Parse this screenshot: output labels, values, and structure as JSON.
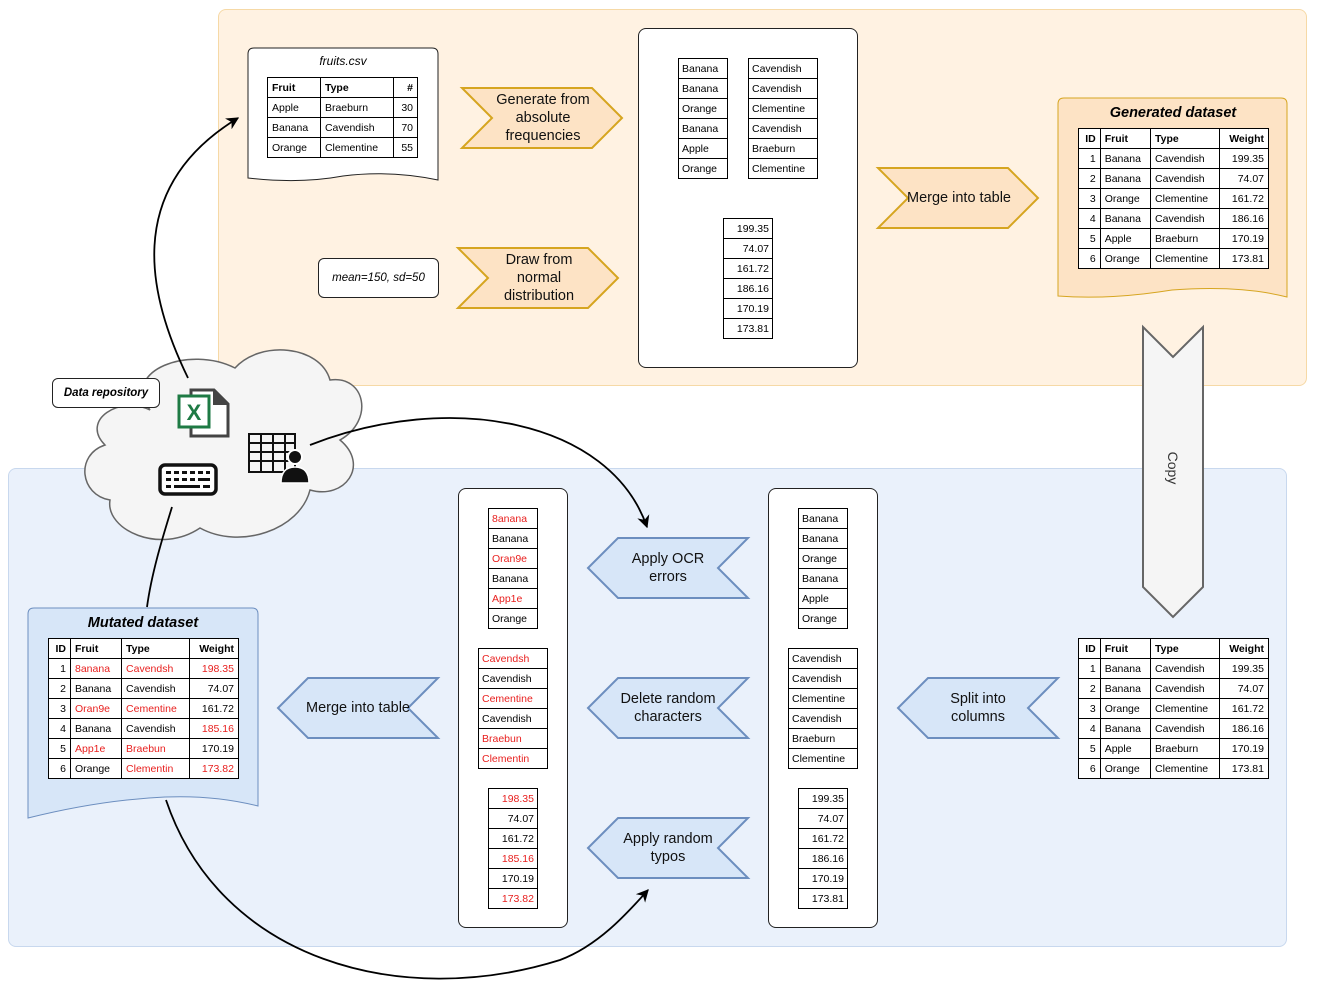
{
  "colors": {
    "top_region_fill": "#fff2e2",
    "top_step_fill": "#fde3c5",
    "top_step_stroke": "#d6a520",
    "bottom_region_fill": "#eaf1fb",
    "bottom_step_fill": "#d7e6f8",
    "bottom_step_stroke": "#6c8ebf",
    "copy_fill": "#f5f5f5",
    "copy_stroke": "#666666",
    "mutation_text": "#e8201f",
    "excel_green": "#1e7a44"
  },
  "repository": {
    "label": "Data repository",
    "icons": [
      "excel-file-icon",
      "keyboard-icon",
      "spreadsheet-user-icon"
    ]
  },
  "source_file": {
    "title": "fruits.csv",
    "headers": [
      "Fruit",
      "Type",
      "#"
    ],
    "rows": [
      [
        "Apple",
        "Braeburn",
        "30"
      ],
      [
        "Banana",
        "Cavendish",
        "70"
      ],
      [
        "Orange",
        "Clementine",
        "55"
      ]
    ]
  },
  "distribution_params": "mean=150, sd=50",
  "steps_top": {
    "generate": "Generate from absolute frequencies",
    "draw": "Draw from normal distribution",
    "merge": "Merge into table"
  },
  "generated_columns": {
    "fruit": [
      "Banana",
      "Banana",
      "Orange",
      "Banana",
      "Apple",
      "Orange"
    ],
    "type": [
      "Cavendish",
      "Cavendish",
      "Clementine",
      "Cavendish",
      "Braeburn",
      "Clementine"
    ],
    "weight": [
      "199.35",
      "74.07",
      "161.72",
      "186.16",
      "170.19",
      "173.81"
    ]
  },
  "generated_dataset": {
    "title": "Generated dataset",
    "headers": [
      "ID",
      "Fruit",
      "Type",
      "Weight"
    ],
    "rows": [
      [
        "1",
        "Banana",
        "Cavendish",
        "199.35"
      ],
      [
        "2",
        "Banana",
        "Cavendish",
        "74.07"
      ],
      [
        "3",
        "Orange",
        "Clementine",
        "161.72"
      ],
      [
        "4",
        "Banana",
        "Cavendish",
        "186.16"
      ],
      [
        "5",
        "Apple",
        "Braeburn",
        "170.19"
      ],
      [
        "6",
        "Orange",
        "Clementine",
        "173.81"
      ]
    ]
  },
  "copy_label": "Copy",
  "copied_dataset": {
    "headers": [
      "ID",
      "Fruit",
      "Type",
      "Weight"
    ],
    "rows": [
      [
        "1",
        "Banana",
        "Cavendish",
        "199.35"
      ],
      [
        "2",
        "Banana",
        "Cavendish",
        "74.07"
      ],
      [
        "3",
        "Orange",
        "Clementine",
        "161.72"
      ],
      [
        "4",
        "Banana",
        "Cavendish",
        "186.16"
      ],
      [
        "5",
        "Apple",
        "Braeburn",
        "170.19"
      ],
      [
        "6",
        "Orange",
        "Clementine",
        "173.81"
      ]
    ]
  },
  "steps_bottom": {
    "split": "Split into columns",
    "ocr": "Apply OCR errors",
    "delete": "Delete random characters",
    "typos": "Apply random typos",
    "merge": "Merge into table"
  },
  "split_columns": {
    "fruit": [
      "Banana",
      "Banana",
      "Orange",
      "Banana",
      "Apple",
      "Orange"
    ],
    "type": [
      "Cavendish",
      "Cavendish",
      "Clementine",
      "Cavendish",
      "Braeburn",
      "Clementine"
    ],
    "weight": [
      "199.35",
      "74.07",
      "161.72",
      "186.16",
      "170.19",
      "173.81"
    ]
  },
  "mutated_columns": {
    "fruit": [
      {
        "v": "8anana",
        "m": true
      },
      {
        "v": "Banana",
        "m": false
      },
      {
        "v": "Oran9e",
        "m": true
      },
      {
        "v": "Banana",
        "m": false
      },
      {
        "v": "App1e",
        "m": true
      },
      {
        "v": "Orange",
        "m": false
      }
    ],
    "type": [
      {
        "v": "Cavendsh",
        "m": true
      },
      {
        "v": "Cavendish",
        "m": false
      },
      {
        "v": "Cementine",
        "m": true
      },
      {
        "v": "Cavendish",
        "m": false
      },
      {
        "v": "Braebun",
        "m": true
      },
      {
        "v": "Clementin",
        "m": true
      }
    ],
    "weight": [
      {
        "v": "198.35",
        "m": true
      },
      {
        "v": "74.07",
        "m": false
      },
      {
        "v": "161.72",
        "m": false
      },
      {
        "v": "185.16",
        "m": true
      },
      {
        "v": "170.19",
        "m": false
      },
      {
        "v": "173.82",
        "m": true
      }
    ]
  },
  "mutated_dataset": {
    "title": "Mutated dataset",
    "headers": [
      "ID",
      "Fruit",
      "Type",
      "Weight"
    ],
    "rows": [
      [
        {
          "v": "1"
        },
        {
          "v": "8anana",
          "m": true
        },
        {
          "v": "Cavendsh",
          "m": true
        },
        {
          "v": "198.35",
          "m": true
        }
      ],
      [
        {
          "v": "2"
        },
        {
          "v": "Banana"
        },
        {
          "v": "Cavendish"
        },
        {
          "v": "74.07"
        }
      ],
      [
        {
          "v": "3"
        },
        {
          "v": "Oran9e",
          "m": true
        },
        {
          "v": "Cementine",
          "m": true
        },
        {
          "v": "161.72"
        }
      ],
      [
        {
          "v": "4"
        },
        {
          "v": "Banana"
        },
        {
          "v": "Cavendish"
        },
        {
          "v": "185.16",
          "m": true
        }
      ],
      [
        {
          "v": "5"
        },
        {
          "v": "App1e",
          "m": true
        },
        {
          "v": "Braebun",
          "m": true
        },
        {
          "v": "170.19"
        }
      ],
      [
        {
          "v": "6"
        },
        {
          "v": "Orange"
        },
        {
          "v": "Clementin",
          "m": true
        },
        {
          "v": "173.82",
          "m": true
        }
      ]
    ]
  }
}
